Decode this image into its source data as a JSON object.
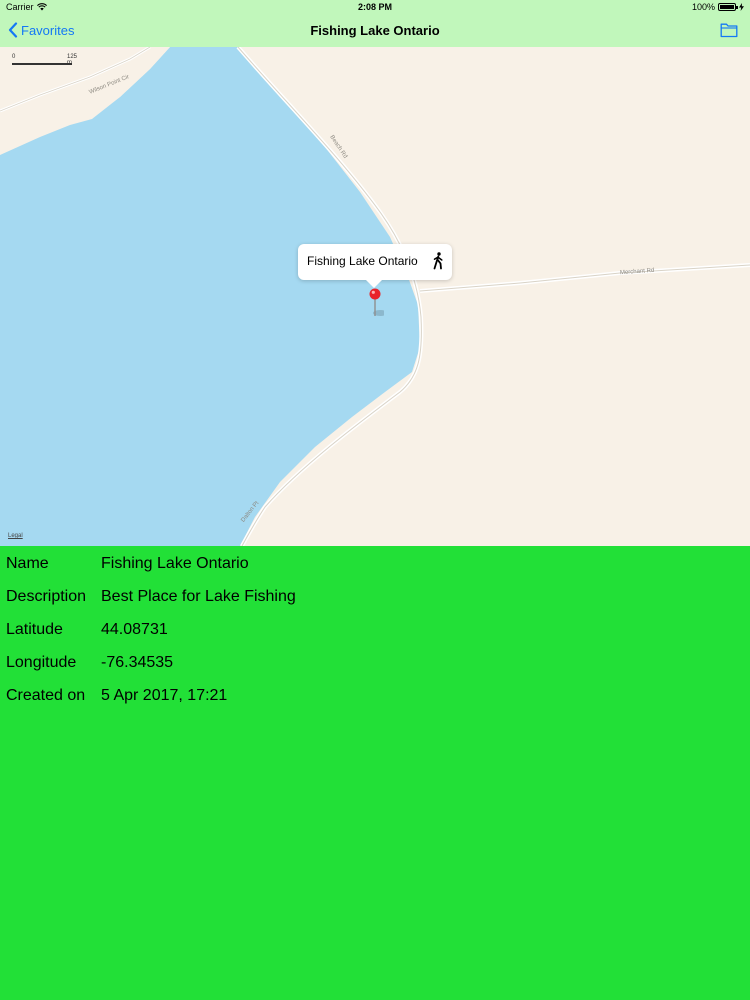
{
  "status_bar": {
    "carrier": "Carrier",
    "time": "2:08 PM",
    "battery": "100%",
    "battery_level": 1.0
  },
  "nav": {
    "back_label": "Favorites",
    "title": "Fishing Lake Ontario",
    "right_icon": "folder-icon"
  },
  "map": {
    "scale_start": "0",
    "scale_end": "125 m",
    "legal": "Legal",
    "road_labels": [
      "Wilson Point Cir",
      "Beach Rd",
      "Merchant Rd",
      "Dalton Pt"
    ],
    "callout_title": "Fishing Lake Ontario",
    "callout_icon": "walking-person-icon",
    "pin_icon": "map-pin-icon",
    "colors": {
      "water": "#a5d9f1",
      "land": "#f8f1e7",
      "pin": "#e8232a"
    }
  },
  "details": {
    "name_label": "Name",
    "name_value": "Fishing Lake Ontario",
    "description_label": "Description",
    "description_value": "Best Place for Lake Fishing",
    "latitude_label": "Latitude",
    "latitude_value": "44.08731",
    "longitude_label": "Longitude",
    "longitude_value": "-76.34535",
    "created_label": "Created on",
    "created_value": "5 Apr 2017, 17:21"
  },
  "colors": {
    "nav_bg": "#c1f7bb",
    "details_bg": "#22e037",
    "accent": "#1478f5"
  }
}
